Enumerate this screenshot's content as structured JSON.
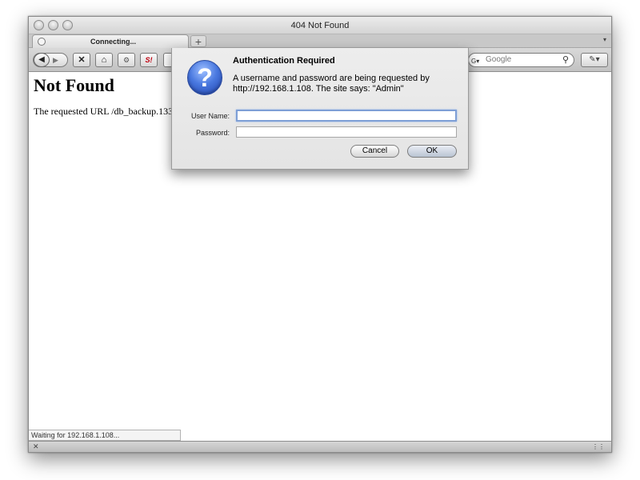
{
  "window": {
    "title": "404 Not Found"
  },
  "tab": {
    "label": "Connecting...",
    "new_tab_label": "+",
    "list_label": "▾"
  },
  "toolbar": {
    "back_glyph": "◀",
    "forward_glyph": "▶",
    "stop_glyph": "✕",
    "home_glyph": "⌂",
    "ext1_glyph": "⚙",
    "ext2_glyph": "S!",
    "pen_glyph": "✎▾"
  },
  "search": {
    "engine_glyph": "G▾",
    "placeholder": "Google",
    "magnifier_glyph": "⚲"
  },
  "page": {
    "heading": "Not Found",
    "body": "The requested URL /db_backup.13312"
  },
  "status": {
    "text": "Waiting for 192.168.1.108...",
    "addon_close": "✕",
    "grip": "⋮⋮"
  },
  "dialog": {
    "icon_glyph": "?",
    "title": "Authentication Required",
    "message": "A username and password are being requested by http://192.168.1.108. The site says: \"Admin\"",
    "user_label": "User Name:",
    "password_label": "Password:",
    "user_value": "",
    "password_value": "",
    "cancel_label": "Cancel",
    "ok_label": "OK"
  },
  "colors": {
    "dialog_icon": "#4a79e0",
    "focus_ring": "#7e9fd6"
  }
}
